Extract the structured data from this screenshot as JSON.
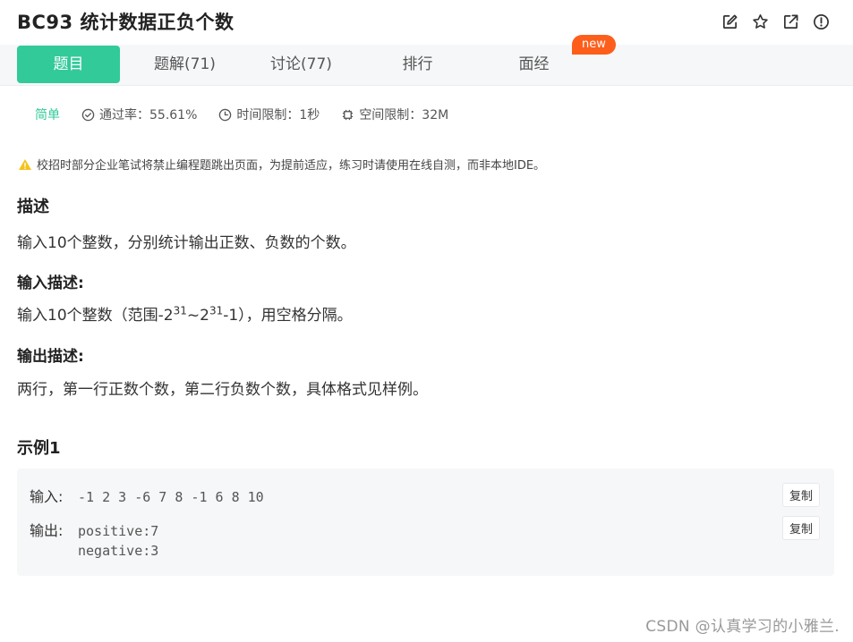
{
  "header": {
    "title": "BC93  统计数据正负个数",
    "actions": [
      "edit-icon",
      "star-icon",
      "external-link-icon",
      "report-icon"
    ]
  },
  "tabs": [
    {
      "label": "题目",
      "active": true
    },
    {
      "label": "题解(71)"
    },
    {
      "label": "讨论(77)"
    },
    {
      "label": "排行"
    },
    {
      "label": "面经"
    }
  ],
  "new_badge": "new",
  "meta": {
    "difficulty": "简单",
    "pass_rate": "通过率：55.61%",
    "time_limit": "时间限制：1秒",
    "space_limit": "空间限制：32M"
  },
  "notice": "校招时部分企业笔试将禁止编程题跳出页面，为提前适应，练习时请使用在线自测，而非本地IDE。",
  "description": {
    "heading": "描述",
    "text": "输入10个整数，分别统计输出正数、负数的个数。"
  },
  "input_desc": {
    "heading": "输入描述:",
    "prefix": "输入10个整数（范围-2",
    "sup1": "31",
    "mid": "~2",
    "sup2": "31",
    "suffix": "-1），用空格分隔。"
  },
  "output_desc": {
    "heading": "输出描述:",
    "text": "两行，第一行正数个数，第二行负数个数，具体格式见样例。"
  },
  "example": {
    "heading": "示例1",
    "input_label": "输入:",
    "input_value": "-1 2 3 -6 7 8 -1 6 8 10",
    "output_label": "输出:",
    "output_line1": "positive:7",
    "output_line2": "negative:3",
    "copy_label": "复制"
  },
  "watermark": "CSDN @认真学习的小雅兰.",
  "colors": {
    "accent": "#32ca99",
    "badge": "#fd5e1b",
    "warning": "#f5c21b"
  }
}
